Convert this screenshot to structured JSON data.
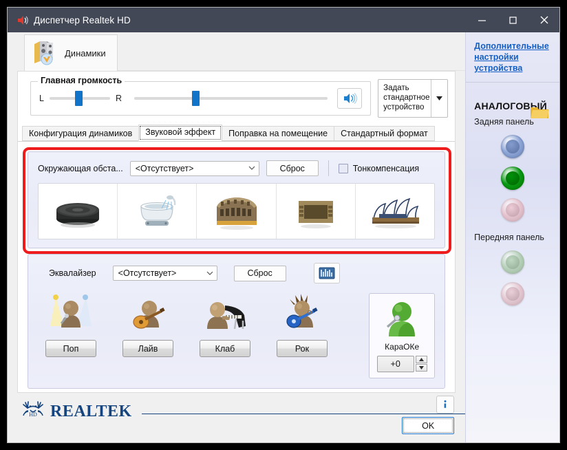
{
  "window": {
    "title": "Диспетчер Realtek HD",
    "app_icon": "speaker-icon",
    "minimize_glyph": "—",
    "maximize_glyph": "▢",
    "close_glyph": "✕"
  },
  "device_tab": {
    "label": "Динамики",
    "icon": "speakers-icon"
  },
  "volume": {
    "legend": "Главная громкость",
    "left_label": "L",
    "right_label": "R",
    "balance_percent": 42,
    "main_percent": 30,
    "mute_button_icon": "volume-speaker-icon"
  },
  "default_device_button": {
    "line1": "Задать",
    "line2": "стандартное",
    "line3": "устройство",
    "arrow_glyph": "▼"
  },
  "tabs": [
    {
      "label": "Конфигурация динамиков",
      "active": false
    },
    {
      "label": "Звуковой эффект",
      "active": true
    },
    {
      "label": "Поправка на помещение",
      "active": false
    },
    {
      "label": "Стандартный формат",
      "active": false
    }
  ],
  "environment": {
    "label": "Окружающая обста...",
    "value": "<Отсутствует>",
    "dropdown_arrow": "⌄",
    "reset_label": "Сброс",
    "loudness_label": "Тонкомпенсация",
    "loudness_checked": false,
    "presets": [
      {
        "name": "sewer-pipe-preset",
        "icon": "sewer-pipe-icon"
      },
      {
        "name": "bathroom-preset",
        "icon": "bathtub-icon"
      },
      {
        "name": "arena-preset",
        "icon": "colosseum-icon"
      },
      {
        "name": "stone-room-preset",
        "icon": "stone-room-icon"
      },
      {
        "name": "concert-hall-preset",
        "icon": "opera-house-icon"
      }
    ]
  },
  "equalizer": {
    "label": "Эквалайзер",
    "value": "<Отсутствует>",
    "dropdown_arrow": "⌄",
    "reset_label": "Сброс",
    "eq_panel_button_icon": "equalizer-grid-icon",
    "presets": [
      {
        "label": "Поп",
        "icon": "singer-spotlight-icon"
      },
      {
        "label": "Лайв",
        "icon": "acoustic-guitarist-icon"
      },
      {
        "label": "Клаб",
        "icon": "pianist-icon"
      },
      {
        "label": "Рок",
        "icon": "rock-guitarist-icon"
      }
    ]
  },
  "karaoke": {
    "label": "КараОКе",
    "icon": "karaoke-singer-icon",
    "value": "+0",
    "up_glyph": "▲",
    "down_glyph": "▼"
  },
  "sidebar": {
    "link": "Дополнительные настройки устройства",
    "folder_icon": "folder-icon",
    "analog_title": "АНАЛОГОВЫЙ",
    "rear_label": "Задняя панель",
    "front_label": "Передняя панель",
    "rear_jacks": [
      {
        "name": "jack-rear-blue",
        "color": "#8fa7d8",
        "active": true
      },
      {
        "name": "jack-rear-green",
        "color": "#0a9b15",
        "active": true
      },
      {
        "name": "jack-rear-pink",
        "color": "#e9b9c2",
        "active": false
      }
    ],
    "front_jacks": [
      {
        "name": "jack-front-green",
        "color": "#a7c9a4",
        "active": false
      },
      {
        "name": "jack-front-pink",
        "color": "#e4bcc4",
        "active": false
      }
    ]
  },
  "footer": {
    "logo_text": "REALTEK",
    "logo_icon": "realtek-antler-icon",
    "info_glyph": "i",
    "ok_label": "OK"
  },
  "annotation": {
    "highlight_color": "#ee1c1c",
    "target": "environment-section"
  }
}
